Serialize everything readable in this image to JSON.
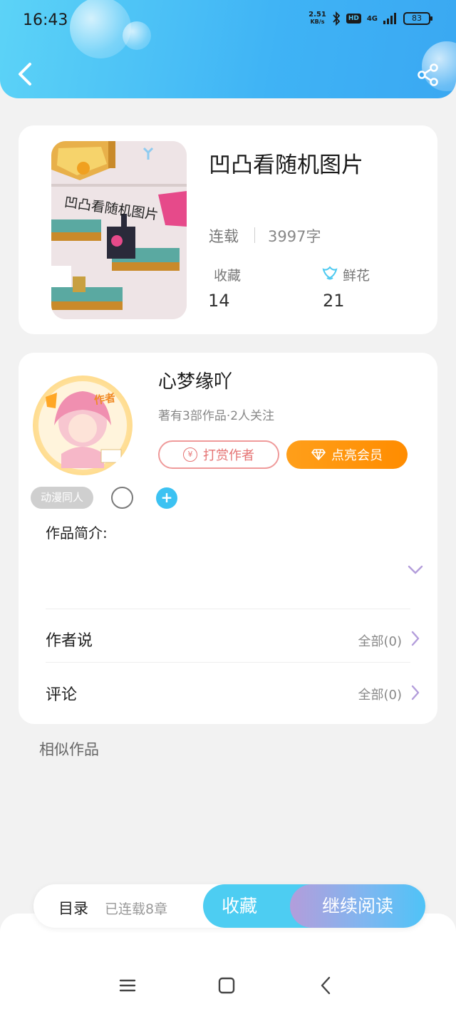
{
  "status_bar": {
    "time": "16:43",
    "net_speed_top": "2.51",
    "net_speed_bottom": "KB/s",
    "hd": "HD",
    "signal": "4G",
    "battery": "83"
  },
  "book": {
    "title": "凹凸看随机图片",
    "status": "连载",
    "word_count": "3997字",
    "favorites_label": "收藏",
    "favorites_count": "14",
    "flowers_label": "鲜花",
    "flowers_count": "21",
    "cover_text": "凹凸看随机图片"
  },
  "author": {
    "badge": "作者",
    "name": "心梦缘吖",
    "meta": "著有3部作品·2人关注",
    "tip_label": "打赏作者",
    "tip_icon": "¥",
    "vip_label": "点亮会员",
    "tag": "动漫同人",
    "plus": "+"
  },
  "sections": {
    "intro_label": "作品简介:",
    "author_says_label": "作者说",
    "author_says_value": "全部(0)",
    "comments_label": "评论",
    "comments_value": "全部(0)",
    "similar_label": "相似作品"
  },
  "action_bar": {
    "toc_label": "目录",
    "toc_sub": "已连载8章",
    "favorite_label": "收藏",
    "continue_label": "继续阅读"
  },
  "icons": [
    "back-icon",
    "share-icon",
    "flower-icon",
    "yen-icon",
    "diamond-icon",
    "chevron-down-icon",
    "chevron-right-icon",
    "menu-icon",
    "home-icon",
    "nav-back-icon"
  ],
  "colors": {
    "header": "#3fb3f5",
    "vip": "#ff9f1a",
    "tip": "#e57373",
    "accent": "#4dcdf2"
  }
}
